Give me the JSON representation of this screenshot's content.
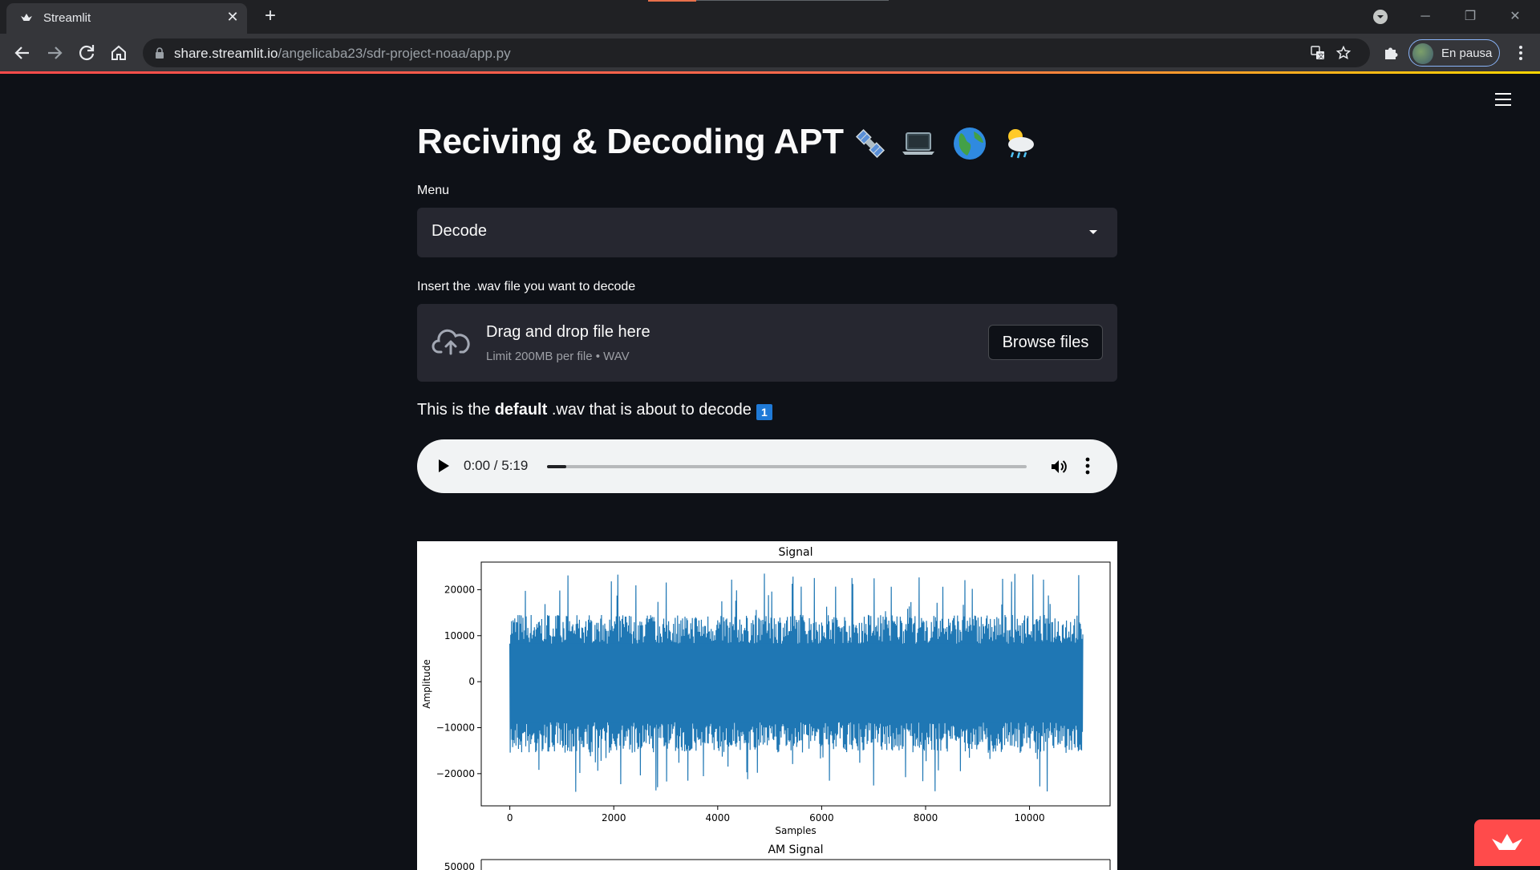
{
  "browser": {
    "tab_title": "Streamlit",
    "tab_close": "✕",
    "new_tab": "+",
    "url_host": "share.streamlit.io",
    "url_path": "/angelicaba23/sdr-project-noaa/app.py",
    "profile_label": "En pausa",
    "window_minimize": "─",
    "window_restore": "❐",
    "window_close": "✕"
  },
  "page": {
    "title": "Reciving & Decoding APT",
    "title_emojis": [
      "satellite-emoji",
      "laptop-emoji",
      "globe-emoji",
      "cloud-rain-emoji"
    ],
    "menu_label": "Menu",
    "menu_value": "Decode",
    "upload_label": "Insert the .wav file you want to decode",
    "drop_title": "Drag and drop file here",
    "drop_sub": "Limit 200MB per file • WAV",
    "browse_label": "Browse files",
    "default_pre": "This is the ",
    "default_bold": "default",
    "default_post": " .wav that is about to decode",
    "default_emoji": "1"
  },
  "audio": {
    "time": "0:00 / 5:19",
    "progress": 0.04
  },
  "chart_data": [
    {
      "type": "line",
      "title": "Signal",
      "xlabel": "Samples",
      "ylabel": "Amplitude",
      "xlim": [
        -550,
        11550
      ],
      "ylim": [
        -27000,
        26000
      ],
      "xticks": [
        0,
        2000,
        4000,
        6000,
        8000,
        10000
      ],
      "yticks": [
        20000,
        10000,
        0,
        -10000,
        -20000
      ],
      "xtick_labels": [
        "0",
        "2000",
        "4000",
        "6000",
        "8000",
        "10000"
      ],
      "ytick_labels": [
        "20000",
        "10000",
        "0",
        "−10000",
        "−20000"
      ],
      "x_range": [
        0,
        11025
      ],
      "envelope_upper_approx": 15000,
      "envelope_lower_approx": -16000,
      "peak_max": 23500,
      "peak_min": -24000,
      "color": "#1f77b4",
      "grid": false
    },
    {
      "type": "line",
      "title": "AM Signal",
      "ytick_labels": [
        "50000"
      ]
    }
  ],
  "colors": {
    "accent": "#ff4b4b",
    "background": "#0e1117",
    "widget": "#262730"
  }
}
